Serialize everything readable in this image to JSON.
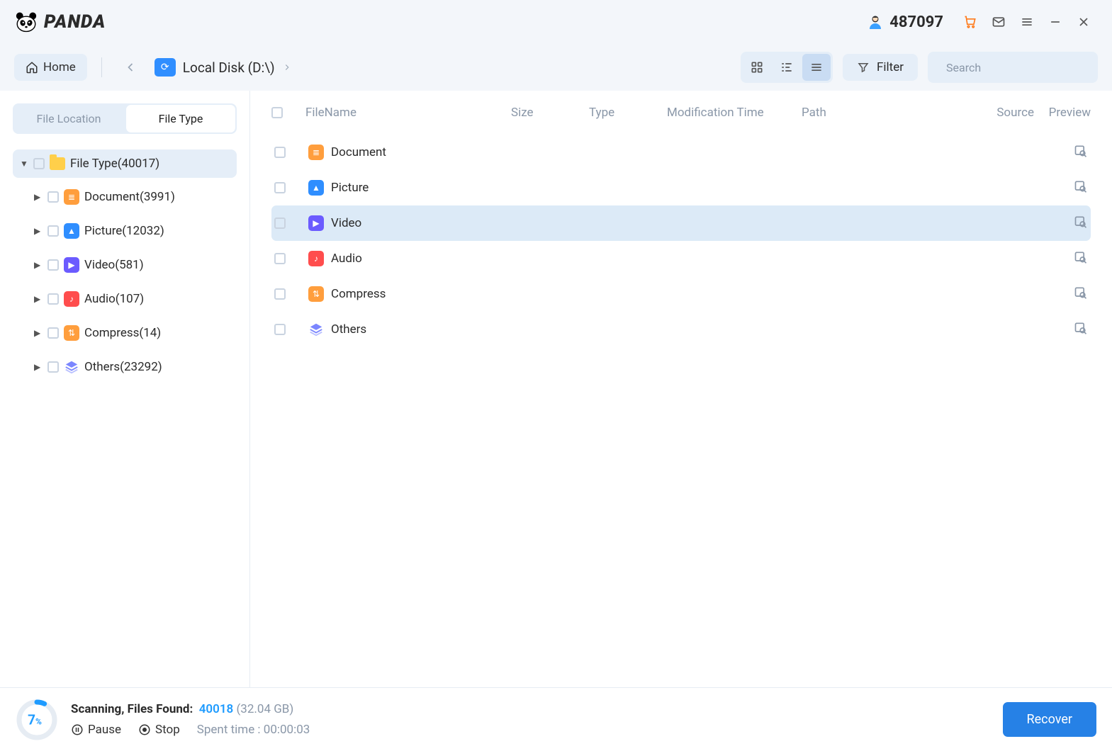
{
  "brand": "PANDA",
  "user_count": "487097",
  "home_label": "Home",
  "breadcrumb": {
    "location": "Local Disk (D:\\)"
  },
  "filter_label": "Filter",
  "search": {
    "placeholder": "Search"
  },
  "sidebar": {
    "tabs": {
      "location": "File Location",
      "type": "File Type"
    },
    "root": {
      "label": "File Type(40017)"
    },
    "items": [
      {
        "label": "Document(3991)",
        "icon": "doc",
        "glyph": "≣"
      },
      {
        "label": "Picture(12032)",
        "icon": "pic",
        "glyph": "▲"
      },
      {
        "label": "Video(581)",
        "icon": "vid",
        "glyph": "▶"
      },
      {
        "label": "Audio(107)",
        "icon": "aud",
        "glyph": "♪"
      },
      {
        "label": "Compress(14)",
        "icon": "zip",
        "glyph": "⇅"
      },
      {
        "label": "Others(23292)",
        "icon": "oth",
        "glyph": ""
      }
    ]
  },
  "columns": {
    "name": "FileName",
    "size": "Size",
    "type": "Type",
    "mod": "Modification Time",
    "path": "Path",
    "source": "Source",
    "preview": "Preview"
  },
  "rows": [
    {
      "name": "Document",
      "icon": "doc",
      "glyph": "≣",
      "selected": false
    },
    {
      "name": "Picture",
      "icon": "pic",
      "glyph": "▲",
      "selected": false
    },
    {
      "name": "Video",
      "icon": "vid",
      "glyph": "▶",
      "selected": true
    },
    {
      "name": "Audio",
      "icon": "aud",
      "glyph": "♪",
      "selected": false
    },
    {
      "name": "Compress",
      "icon": "zip",
      "glyph": "⇅",
      "selected": false
    },
    {
      "name": "Others",
      "icon": "oth",
      "glyph": "",
      "selected": false
    }
  ],
  "footer": {
    "percent": "7",
    "status_label": "Scanning, Files Found:",
    "found_count": "40018",
    "found_size": "(32.04 GB)",
    "pause": "Pause",
    "stop": "Stop",
    "spent_label": "Spent time : ",
    "spent_value": "00:00:03",
    "recover": "Recover"
  }
}
